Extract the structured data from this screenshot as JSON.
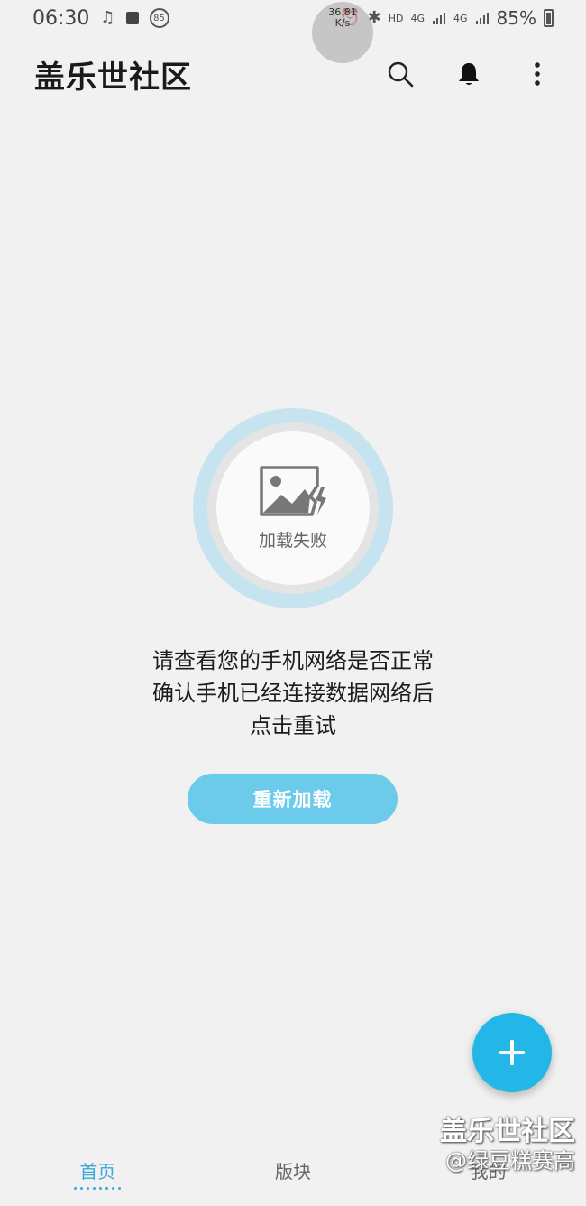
{
  "status_bar": {
    "time": "06:30",
    "badge": "85",
    "net_speed_value": "36.81",
    "net_speed_unit": "K/s",
    "hd": "HD",
    "net1": "4G",
    "net2": "4G",
    "battery": "85%"
  },
  "app_bar": {
    "title": "盖乐世社区",
    "icons": [
      "search-icon",
      "bell-icon",
      "more-vert-icon"
    ]
  },
  "error": {
    "image_label": "加载失败",
    "message_lines": [
      "请查看您的手机网络是否正常",
      "确认手机已经连接数据网络后",
      "点击重试"
    ],
    "retry_button": "重新加载"
  },
  "fab": {
    "icon": "plus-icon"
  },
  "bottom_nav": {
    "items": [
      {
        "label": "首页",
        "active": true
      },
      {
        "label": "版块",
        "active": false
      },
      {
        "label": "我的",
        "active": false
      }
    ]
  },
  "watermark": {
    "line1": "盖乐世社区",
    "line2": "@绿豆糕赛高"
  },
  "colors": {
    "accent": "#22b7e6",
    "button": "#6ccaea",
    "active_tab": "#3aa8d8",
    "background": "#f1f1f1"
  }
}
